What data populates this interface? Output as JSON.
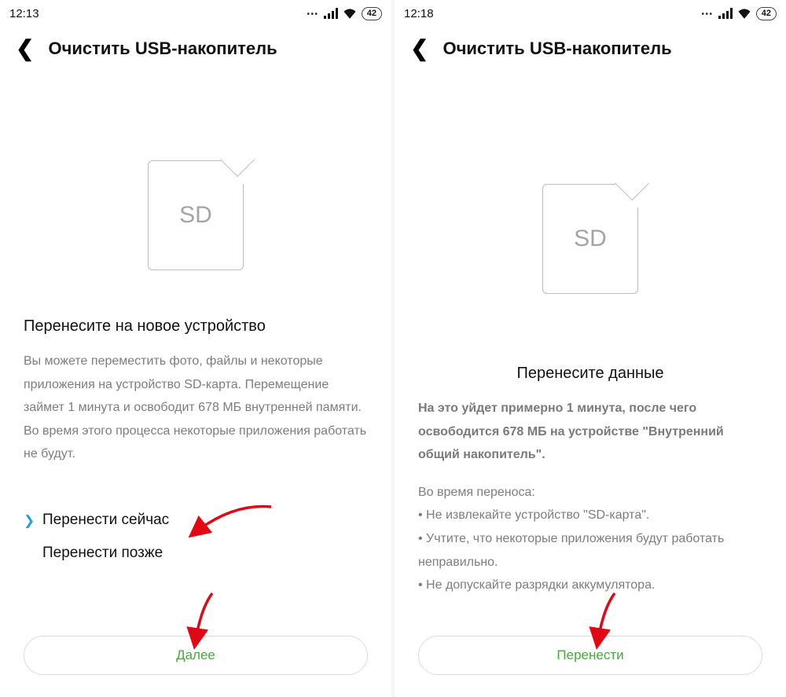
{
  "screens": [
    {
      "status": {
        "time": "12:13",
        "battery": "42"
      },
      "header": {
        "title": "Очистить USB-накопитель"
      },
      "sd_label": "SD",
      "subhead": "Перенесите на новое устройство",
      "description": "Вы можете переместить фото, файлы и некоторые приложения на устройство SD-карта. Перемещение займет 1 минута и освободит 678 МБ внутренней памяти. Во время этого процесса некоторые приложения работать не будут.",
      "options": [
        {
          "label": "Перенести сейчас",
          "selected": true
        },
        {
          "label": "Перенести позже",
          "selected": false
        }
      ],
      "button": "Далее"
    },
    {
      "status": {
        "time": "12:18",
        "battery": "42"
      },
      "header": {
        "title": "Очистить USB-накопитель"
      },
      "sd_label": "SD",
      "subhead": "Перенесите данные",
      "description1": "На это уйдет примерно 1 минута, после чего освободится 678 МБ на устройстве \"Внутренний общий накопитель\".",
      "description2_title": "Во время переноса:",
      "bullets": [
        "Не извлекайте устройство \"SD-карта\".",
        "Учтите, что некоторые приложения будут работать неправильно.",
        "Не допускайте разрядки аккумулятора."
      ],
      "button": "Перенести"
    }
  ]
}
